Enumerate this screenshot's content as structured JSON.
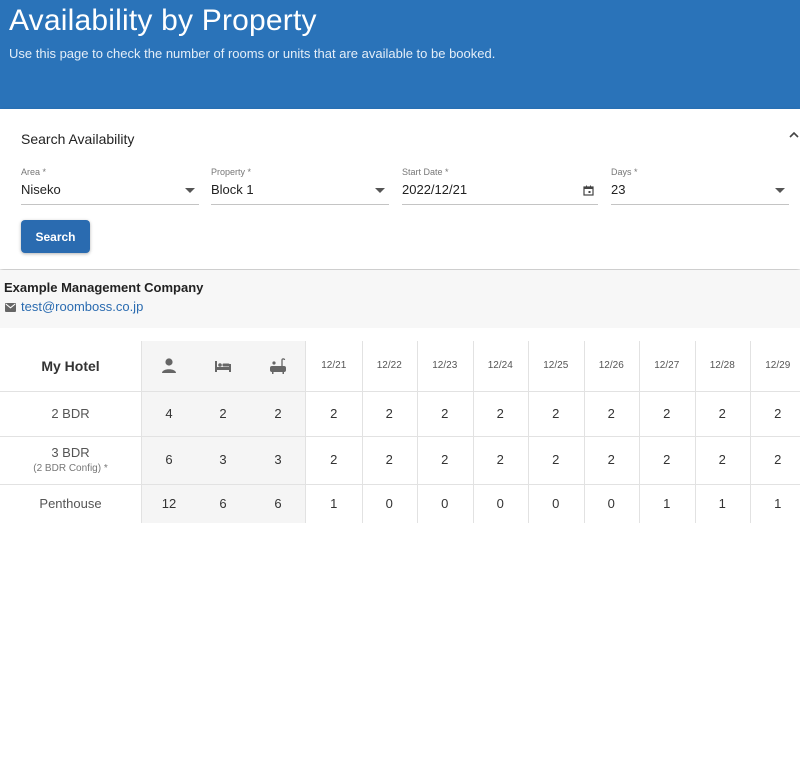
{
  "header": {
    "title": "Availability by Property",
    "subtitle": "Use this page to check the number of rooms or units that are available to be booked."
  },
  "search": {
    "title": "Search Availability",
    "fields": [
      {
        "label": "Area *",
        "value": "Niseko",
        "control": "dropdown"
      },
      {
        "label": "Property *",
        "value": "Block 1",
        "control": "dropdown"
      },
      {
        "label": "Start Date *",
        "value": "2022/12/21",
        "control": "date"
      },
      {
        "label": "Days *",
        "value": "23",
        "control": "dropdown"
      }
    ],
    "button_label": "Search"
  },
  "company": {
    "name": "Example Management Company",
    "email": "test@roomboss.co.jp"
  },
  "table": {
    "hotel_name": "My Hotel",
    "icon_columns": [
      "person-icon",
      "bed-icon",
      "bath-icon"
    ],
    "dates": [
      "12/21",
      "12/22",
      "12/23",
      "12/24",
      "12/25",
      "12/26",
      "12/27",
      "12/28",
      "12/29"
    ],
    "rows": [
      {
        "name": "2 BDR",
        "sub": "",
        "guests": "4",
        "beds": "2",
        "baths": "2",
        "avail": [
          "2",
          "2",
          "2",
          "2",
          "2",
          "2",
          "2",
          "2",
          "2"
        ]
      },
      {
        "name": "3 BDR",
        "sub": "(2 BDR Config) *",
        "guests": "6",
        "beds": "3",
        "baths": "3",
        "avail": [
          "2",
          "2",
          "2",
          "2",
          "2",
          "2",
          "2",
          "2",
          "2"
        ]
      },
      {
        "name": "Penthouse",
        "sub": "",
        "guests": "12",
        "beds": "6",
        "baths": "6",
        "avail": [
          "1",
          "0",
          "0",
          "0",
          "0",
          "0",
          "1",
          "1",
          "1"
        ]
      }
    ]
  },
  "colors": {
    "header_bg": "#2a73b9",
    "button_bg": "#2a6bb0",
    "link": "#2a6bb0"
  }
}
